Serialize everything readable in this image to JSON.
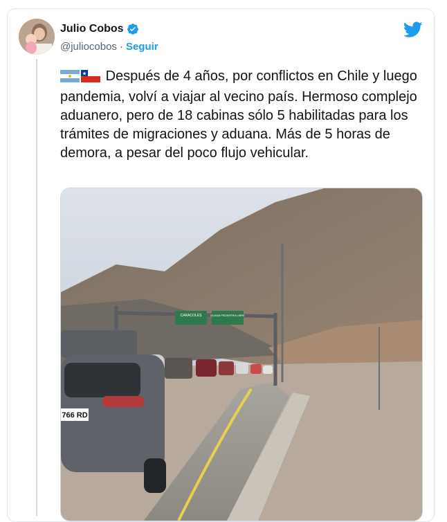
{
  "author": {
    "name": "Julio Cobos",
    "handle": "@juliocobos",
    "separator": "·",
    "follow_label": "Seguir"
  },
  "tweet": {
    "text": "Después de 4 años, por conflictos en Chile y luego pandemia, volví a viajar al vecino país. Hermoso complejo aduanero, pero de 18 cabinas sólo 5 habilitadas para los trámites de migraciones y aduana. Más de 5 horas de demora, a pesar del poco flujo vehicular.",
    "flags": [
      "argentina-flag-icon",
      "chile-flag-icon"
    ]
  },
  "media": {
    "plate_text": "766 RD",
    "sign_left": "CARACOLES",
    "sign_right": "DUANA FRONTERA LIBRE"
  },
  "colors": {
    "accent": "#1d9bf0",
    "text": "#0f1419",
    "secondary": "#536471",
    "border": "#cfd9de"
  }
}
